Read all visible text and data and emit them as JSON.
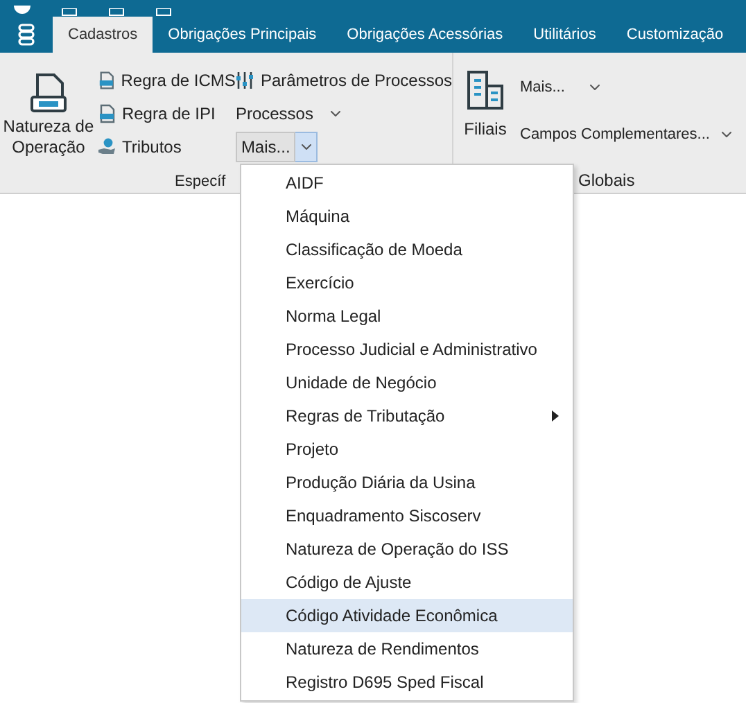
{
  "tabs": [
    {
      "label": "Cadastros",
      "selected": true
    },
    {
      "label": "Obrigações Principais",
      "selected": false
    },
    {
      "label": "Obrigações Acessórias",
      "selected": false
    },
    {
      "label": "Utilitários",
      "selected": false
    },
    {
      "label": "Customização",
      "selected": false
    }
  ],
  "ribbon": {
    "big_button": "Natureza de Operação",
    "small_buttons": [
      {
        "label": "Regra de ICMS"
      },
      {
        "label": "Regra de IPI"
      },
      {
        "label": "Tributos"
      }
    ],
    "col2": [
      {
        "label": "Parâmetros de Processos",
        "kind": "button"
      },
      {
        "label": "Processos",
        "kind": "dropdown"
      },
      {
        "label": "Mais...",
        "kind": "split",
        "expanded": true
      }
    ],
    "group1_label": "Específ",
    "filiais": "Filiais",
    "col4": [
      {
        "label": "Mais..."
      },
      {
        "label": "Campos Complementares..."
      }
    ],
    "group2_label": "Globais"
  },
  "menu": [
    {
      "label": "AIDF",
      "selected": false
    },
    {
      "label": "Máquina",
      "selected": false
    },
    {
      "label": "Classificação de Moeda",
      "selected": false
    },
    {
      "label": "Exercício",
      "selected": false
    },
    {
      "label": "Norma Legal",
      "selected": false
    },
    {
      "label": "Processo Judicial e Administrativo",
      "selected": false
    },
    {
      "label": "Unidade de Negócio",
      "selected": false
    },
    {
      "label": "Regras de Tributação",
      "selected": false,
      "submenu": true
    },
    {
      "label": "Projeto",
      "selected": false
    },
    {
      "label": "Produção Diária da Usina",
      "selected": false
    },
    {
      "label": "Enquadramento Siscoserv",
      "selected": false
    },
    {
      "label": "Natureza de Operação do ISS",
      "selected": false
    },
    {
      "label": "Código de Ajuste",
      "selected": false
    },
    {
      "label": "Código Atividade Econômica",
      "selected": true
    },
    {
      "label": "Natureza de Rendimentos",
      "selected": false
    },
    {
      "label": "Registro D695 Sped Fiscal",
      "selected": false
    }
  ]
}
